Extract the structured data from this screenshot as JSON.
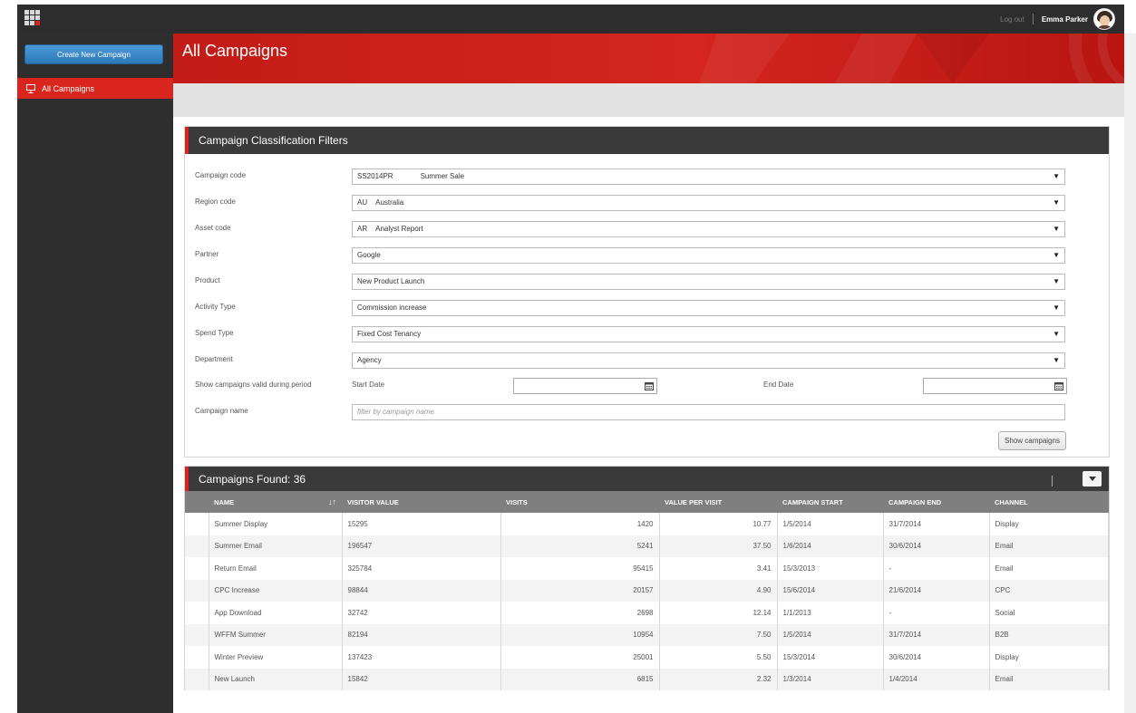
{
  "topbar": {
    "logout_label": "Log out",
    "user_name": "Emma Parker"
  },
  "sidebar": {
    "create_button_label": "Create New Campaign",
    "items": [
      {
        "label": "All Campaigns",
        "icon": "presentation-icon",
        "active": true
      }
    ]
  },
  "header": {
    "title": "All Campaigns"
  },
  "filters": {
    "title": "Campaign Classification Filters",
    "fields": [
      {
        "label": "Campaign code",
        "code": "SS2014PR",
        "value": "Summer Sale"
      },
      {
        "label": "Region code",
        "code": "AU",
        "value": "Australia"
      },
      {
        "label": "Asset code",
        "code": "AR",
        "value": "Analyst Report"
      },
      {
        "label": "Partner",
        "code": "",
        "value": "Google"
      },
      {
        "label": "Product",
        "code": "",
        "value": "New Product Launch"
      },
      {
        "label": "Activity Type",
        "code": "",
        "value": "Commission increase"
      },
      {
        "label": "Spend Type",
        "code": "",
        "value": "Fixed Cost Tenancy"
      },
      {
        "label": "Department",
        "code": "",
        "value": "Agency"
      }
    ],
    "period": {
      "label": "Show campaigns valid during period",
      "start_label": "Start Date",
      "end_label": "End Date",
      "start_value": "",
      "end_value": ""
    },
    "name_filter": {
      "label": "Campaign  name",
      "placeholder": "filter by campaign name",
      "value": ""
    },
    "show_button_label": "Show campaigns"
  },
  "results": {
    "title": "Campaigns Found: 36",
    "columns": [
      "NAME",
      "VISITOR VALUE",
      "VISITS",
      "VALUE PER VISIT",
      "CAMPAIGN START",
      "CAMPAIGN END",
      "CHANNEL"
    ],
    "rows": [
      {
        "name": "Summer Display",
        "visitor_value": "15295",
        "visits": "1420",
        "value_per_visit": "10.77",
        "start": "1/5/2014",
        "end": "31/7/2014",
        "channel": "Display"
      },
      {
        "name": "Summer Email",
        "visitor_value": "196547",
        "visits": "5241",
        "value_per_visit": "37.50",
        "start": "1/6/2014",
        "end": "30/6/2014",
        "channel": "Email"
      },
      {
        "name": "Return Email",
        "visitor_value": "325784",
        "visits": "95415",
        "value_per_visit": "3.41",
        "start": "15/3/2013",
        "end": "-",
        "channel": "Email"
      },
      {
        "name": "CPC Increase",
        "visitor_value": "98844",
        "visits": "20157",
        "value_per_visit": "4.90",
        "start": "15/6/2014",
        "end": "21/6/2014",
        "channel": "CPC"
      },
      {
        "name": "App Download",
        "visitor_value": "32742",
        "visits": "2698",
        "value_per_visit": "12.14",
        "start": "1/1/2013",
        "end": "-",
        "channel": "Social"
      },
      {
        "name": "WFFM Summer",
        "visitor_value": "82194",
        "visits": "10954",
        "value_per_visit": "7.50",
        "start": "1/5/2014",
        "end": "31/7/2014",
        "channel": "B2B"
      },
      {
        "name": "Winter Preview",
        "visitor_value": "137423",
        "visits": "25001",
        "value_per_visit": "5.50",
        "start": "15/3/2014",
        "end": "30/6/2014",
        "channel": "Display"
      },
      {
        "name": "New Launch",
        "visitor_value": "15842",
        "visits": "6815",
        "value_per_visit": "2.32",
        "start": "1/3/2014",
        "end": "1/4/2014",
        "channel": "Email"
      }
    ]
  },
  "colors": {
    "brand_red": "#d9251d",
    "dark_bar": "#2d2d2d",
    "button_blue": "#2c78b8"
  }
}
